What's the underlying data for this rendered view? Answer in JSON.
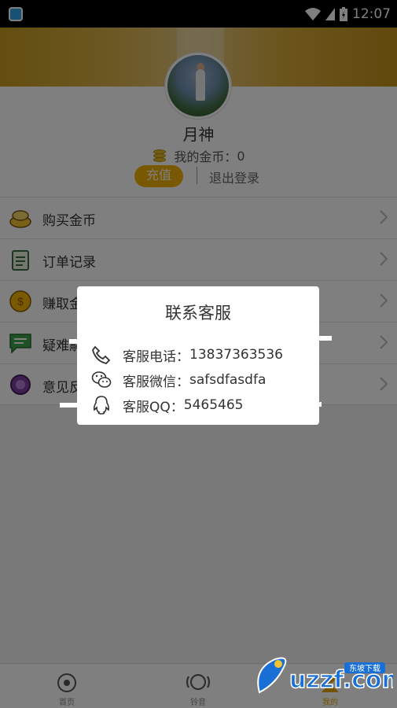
{
  "status_bar": {
    "time": "12:07",
    "icons": [
      "app-icon",
      "wifi-icon",
      "signal-icon",
      "battery-icon"
    ]
  },
  "profile": {
    "username": "月神",
    "coins_label": "我的金币：",
    "coins_value": "0",
    "recharge_label": "充值",
    "logout_label": "退出登录"
  },
  "menu": {
    "items": [
      {
        "label": "购买金币",
        "icon": "coin-purse-icon"
      },
      {
        "label": "订单记录",
        "icon": "clipboard-icon"
      },
      {
        "label": "赚取金币",
        "icon": "gold-coin-icon"
      },
      {
        "label": "疑难解答",
        "icon": "chat-icon"
      },
      {
        "label": "意见反馈",
        "icon": "headset-icon"
      }
    ]
  },
  "tabbar": {
    "tabs": [
      {
        "label": "首页",
        "icon": "home-icon"
      },
      {
        "label": "铃音",
        "icon": "music-icon"
      },
      {
        "label": "我的",
        "icon": "profile-icon",
        "active": true
      }
    ]
  },
  "dialog": {
    "title": "联系客服",
    "phone_label": "客服电话：",
    "phone_value": "13837363536",
    "wechat_label": "客服微信：",
    "wechat_value": "safsdfasdfa",
    "qq_label": "客服QQ：",
    "qq_value": "5465465"
  },
  "watermark": {
    "brand": "uzzf.com",
    "tagline": "东坡下载"
  },
  "colors": {
    "accent": "#f0b000",
    "overlay": "rgba(0,0,0,0.5)",
    "status_bar": "#000000"
  }
}
